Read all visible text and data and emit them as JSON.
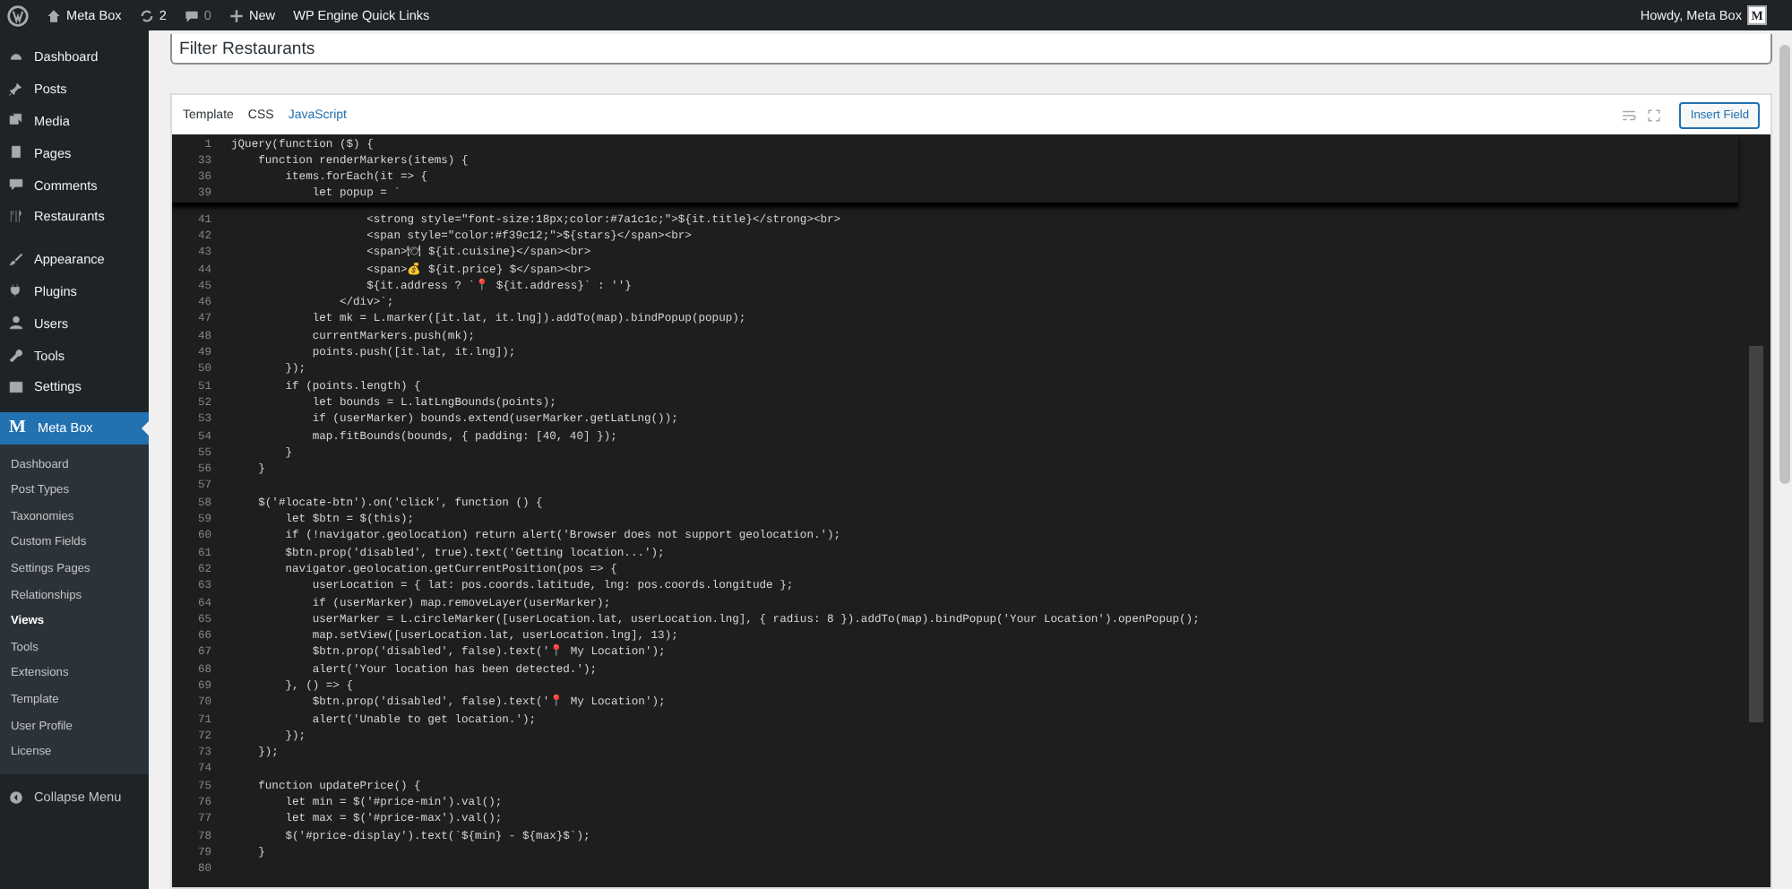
{
  "admin_bar": {
    "site": "Meta Box",
    "updates": "2",
    "comments": "0",
    "new": "New",
    "quick_links": "WP Engine Quick Links",
    "greeting": "Howdy, Meta Box",
    "avatar_letter": "M"
  },
  "sidebar": {
    "items": [
      {
        "label": "Dashboard",
        "selected": false
      },
      {
        "label": "Posts",
        "selected": false
      },
      {
        "label": "Media",
        "selected": false
      },
      {
        "label": "Pages",
        "selected": false
      },
      {
        "label": "Comments",
        "selected": false
      },
      {
        "label": "Restaurants",
        "selected": false
      },
      {
        "label": "Appearance",
        "selected": false
      },
      {
        "label": "Plugins",
        "selected": false
      },
      {
        "label": "Users",
        "selected": false
      },
      {
        "label": "Tools",
        "selected": false
      },
      {
        "label": "Settings",
        "selected": false
      }
    ],
    "current": {
      "logo": "M",
      "label": "Meta Box",
      "selected": true
    },
    "submenu": [
      {
        "label": "Dashboard",
        "selected": false
      },
      {
        "label": "Post Types",
        "selected": false
      },
      {
        "label": "Taxonomies",
        "selected": false
      },
      {
        "label": "Custom Fields",
        "selected": false
      },
      {
        "label": "Settings Pages",
        "selected": false
      },
      {
        "label": "Relationships",
        "selected": false
      },
      {
        "label": "Views",
        "selected": true
      },
      {
        "label": "Tools",
        "selected": false
      },
      {
        "label": "Extensions",
        "selected": false
      },
      {
        "label": "Template",
        "selected": false
      },
      {
        "label": "User Profile",
        "selected": false
      },
      {
        "label": "License",
        "selected": false
      }
    ],
    "collapse": "Collapse Menu"
  },
  "title_field": {
    "value": "Filter Restaurants"
  },
  "editor": {
    "tabs": [
      {
        "label": "Template",
        "selected": false
      },
      {
        "label": "CSS",
        "selected": false
      },
      {
        "label": "JavaScript",
        "selected": true
      }
    ],
    "insert_button": "Insert Field",
    "sticky_lines": [
      {
        "number": "1",
        "text": "jQuery(function ($) {"
      },
      {
        "number": "33",
        "text": "    function renderMarkers(items) {"
      },
      {
        "number": "36",
        "text": "        items.forEach(it => {"
      },
      {
        "number": "39",
        "text": "            let popup = `"
      }
    ],
    "lines": [
      {
        "number": "41",
        "text": "                    <strong style=\"font-size:18px;color:#7a1c1c;\">${it.title}</strong><br>"
      },
      {
        "number": "42",
        "text": "                    <span style=\"color:#f39c12;\">${stars}</span><br>"
      },
      {
        "number": "43",
        "text": "                    <span>🍽 ${it.cuisine}</span><br>"
      },
      {
        "number": "44",
        "text": "                    <span>💰 ${it.price} $</span><br>"
      },
      {
        "number": "45",
        "text": "                    ${it.address ? `📍 ${it.address}` : ''}"
      },
      {
        "number": "46",
        "text": "                </div>`;"
      },
      {
        "number": "47",
        "text": "            let mk = L.marker([it.lat, it.lng]).addTo(map).bindPopup(popup);"
      },
      {
        "number": "48",
        "text": "            currentMarkers.push(mk);"
      },
      {
        "number": "49",
        "text": "            points.push([it.lat, it.lng]);"
      },
      {
        "number": "50",
        "text": "        });"
      },
      {
        "number": "51",
        "text": "        if (points.length) {"
      },
      {
        "number": "52",
        "text": "            let bounds = L.latLngBounds(points);"
      },
      {
        "number": "53",
        "text": "            if (userMarker) bounds.extend(userMarker.getLatLng());"
      },
      {
        "number": "54",
        "text": "            map.fitBounds(bounds, { padding: [40, 40] });"
      },
      {
        "number": "55",
        "text": "        }"
      },
      {
        "number": "56",
        "text": "    }"
      },
      {
        "number": "57"
      },
      {
        "number": "58",
        "text": "    $('#locate-btn').on('click', function () {"
      },
      {
        "number": "59",
        "text": "        let $btn = $(this);"
      },
      {
        "number": "60",
        "text": "        if (!navigator.geolocation) return alert('Browser does not support geolocation.');"
      },
      {
        "number": "61",
        "text": "        $btn.prop('disabled', true).text('Getting location...');"
      },
      {
        "number": "62",
        "text": "        navigator.geolocation.getCurrentPosition(pos => {"
      },
      {
        "number": "63",
        "text": "            userLocation = { lat: pos.coords.latitude, lng: pos.coords.longitude };"
      },
      {
        "number": "64",
        "text": "            if (userMarker) map.removeLayer(userMarker);"
      },
      {
        "number": "65",
        "text": "            userMarker = L.circleMarker([userLocation.lat, userLocation.lng], { radius: 8 }).addTo(map).bindPopup('Your Location').openPopup();"
      },
      {
        "number": "66",
        "text": "            map.setView([userLocation.lat, userLocation.lng], 13);"
      },
      {
        "number": "67",
        "text": "            $btn.prop('disabled', false).text('📍 My Location');"
      },
      {
        "number": "68",
        "text": "            alert('Your location has been detected.');"
      },
      {
        "number": "69",
        "text": "        }, () => {"
      },
      {
        "number": "70",
        "text": "            $btn.prop('disabled', false).text('📍 My Location');"
      },
      {
        "number": "71",
        "text": "            alert('Unable to get location.');"
      },
      {
        "number": "72",
        "text": "        });"
      },
      {
        "number": "73",
        "text": "    });"
      },
      {
        "number": "74"
      },
      {
        "number": "75",
        "text": "    function updatePrice() {"
      },
      {
        "number": "76",
        "text": "        let min = $('#price-min').val();"
      },
      {
        "number": "77",
        "text": "        let max = $('#price-max').val();"
      },
      {
        "number": "78",
        "text": "        $('#price-display').text(`${min} - ${max}$`);"
      },
      {
        "number": "79",
        "text": "    }"
      },
      {
        "number": "80"
      }
    ]
  }
}
